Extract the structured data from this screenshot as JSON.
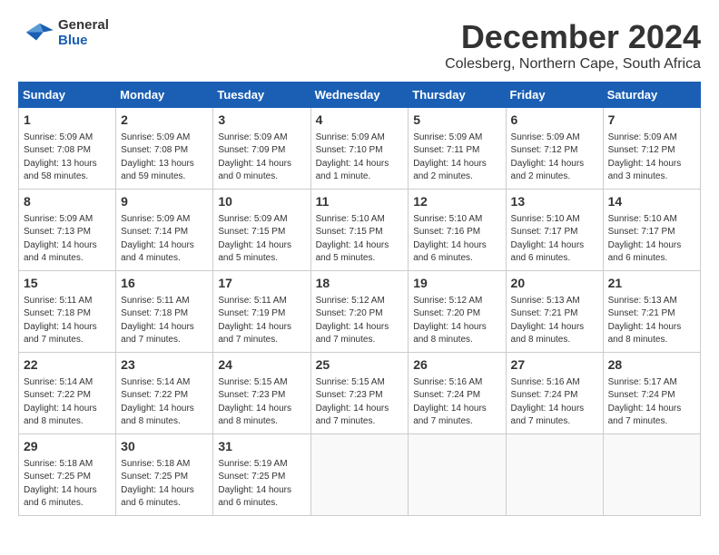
{
  "header": {
    "logo_general": "General",
    "logo_blue": "Blue",
    "month": "December 2024",
    "location": "Colesberg, Northern Cape, South Africa"
  },
  "weekdays": [
    "Sunday",
    "Monday",
    "Tuesday",
    "Wednesday",
    "Thursday",
    "Friday",
    "Saturday"
  ],
  "weeks": [
    [
      {
        "day": "1",
        "info": "Sunrise: 5:09 AM\nSunset: 7:08 PM\nDaylight: 13 hours\nand 58 minutes."
      },
      {
        "day": "2",
        "info": "Sunrise: 5:09 AM\nSunset: 7:08 PM\nDaylight: 13 hours\nand 59 minutes."
      },
      {
        "day": "3",
        "info": "Sunrise: 5:09 AM\nSunset: 7:09 PM\nDaylight: 14 hours\nand 0 minutes."
      },
      {
        "day": "4",
        "info": "Sunrise: 5:09 AM\nSunset: 7:10 PM\nDaylight: 14 hours\nand 1 minute."
      },
      {
        "day": "5",
        "info": "Sunrise: 5:09 AM\nSunset: 7:11 PM\nDaylight: 14 hours\nand 2 minutes."
      },
      {
        "day": "6",
        "info": "Sunrise: 5:09 AM\nSunset: 7:12 PM\nDaylight: 14 hours\nand 2 minutes."
      },
      {
        "day": "7",
        "info": "Sunrise: 5:09 AM\nSunset: 7:12 PM\nDaylight: 14 hours\nand 3 minutes."
      }
    ],
    [
      {
        "day": "8",
        "info": "Sunrise: 5:09 AM\nSunset: 7:13 PM\nDaylight: 14 hours\nand 4 minutes."
      },
      {
        "day": "9",
        "info": "Sunrise: 5:09 AM\nSunset: 7:14 PM\nDaylight: 14 hours\nand 4 minutes."
      },
      {
        "day": "10",
        "info": "Sunrise: 5:09 AM\nSunset: 7:15 PM\nDaylight: 14 hours\nand 5 minutes."
      },
      {
        "day": "11",
        "info": "Sunrise: 5:10 AM\nSunset: 7:15 PM\nDaylight: 14 hours\nand 5 minutes."
      },
      {
        "day": "12",
        "info": "Sunrise: 5:10 AM\nSunset: 7:16 PM\nDaylight: 14 hours\nand 6 minutes."
      },
      {
        "day": "13",
        "info": "Sunrise: 5:10 AM\nSunset: 7:17 PM\nDaylight: 14 hours\nand 6 minutes."
      },
      {
        "day": "14",
        "info": "Sunrise: 5:10 AM\nSunset: 7:17 PM\nDaylight: 14 hours\nand 6 minutes."
      }
    ],
    [
      {
        "day": "15",
        "info": "Sunrise: 5:11 AM\nSunset: 7:18 PM\nDaylight: 14 hours\nand 7 minutes."
      },
      {
        "day": "16",
        "info": "Sunrise: 5:11 AM\nSunset: 7:18 PM\nDaylight: 14 hours\nand 7 minutes."
      },
      {
        "day": "17",
        "info": "Sunrise: 5:11 AM\nSunset: 7:19 PM\nDaylight: 14 hours\nand 7 minutes."
      },
      {
        "day": "18",
        "info": "Sunrise: 5:12 AM\nSunset: 7:20 PM\nDaylight: 14 hours\nand 7 minutes."
      },
      {
        "day": "19",
        "info": "Sunrise: 5:12 AM\nSunset: 7:20 PM\nDaylight: 14 hours\nand 8 minutes."
      },
      {
        "day": "20",
        "info": "Sunrise: 5:13 AM\nSunset: 7:21 PM\nDaylight: 14 hours\nand 8 minutes."
      },
      {
        "day": "21",
        "info": "Sunrise: 5:13 AM\nSunset: 7:21 PM\nDaylight: 14 hours\nand 8 minutes."
      }
    ],
    [
      {
        "day": "22",
        "info": "Sunrise: 5:14 AM\nSunset: 7:22 PM\nDaylight: 14 hours\nand 8 minutes."
      },
      {
        "day": "23",
        "info": "Sunrise: 5:14 AM\nSunset: 7:22 PM\nDaylight: 14 hours\nand 8 minutes."
      },
      {
        "day": "24",
        "info": "Sunrise: 5:15 AM\nSunset: 7:23 PM\nDaylight: 14 hours\nand 8 minutes."
      },
      {
        "day": "25",
        "info": "Sunrise: 5:15 AM\nSunset: 7:23 PM\nDaylight: 14 hours\nand 7 minutes."
      },
      {
        "day": "26",
        "info": "Sunrise: 5:16 AM\nSunset: 7:24 PM\nDaylight: 14 hours\nand 7 minutes."
      },
      {
        "day": "27",
        "info": "Sunrise: 5:16 AM\nSunset: 7:24 PM\nDaylight: 14 hours\nand 7 minutes."
      },
      {
        "day": "28",
        "info": "Sunrise: 5:17 AM\nSunset: 7:24 PM\nDaylight: 14 hours\nand 7 minutes."
      }
    ],
    [
      {
        "day": "29",
        "info": "Sunrise: 5:18 AM\nSunset: 7:25 PM\nDaylight: 14 hours\nand 6 minutes."
      },
      {
        "day": "30",
        "info": "Sunrise: 5:18 AM\nSunset: 7:25 PM\nDaylight: 14 hours\nand 6 minutes."
      },
      {
        "day": "31",
        "info": "Sunrise: 5:19 AM\nSunset: 7:25 PM\nDaylight: 14 hours\nand 6 minutes."
      },
      null,
      null,
      null,
      null
    ]
  ]
}
